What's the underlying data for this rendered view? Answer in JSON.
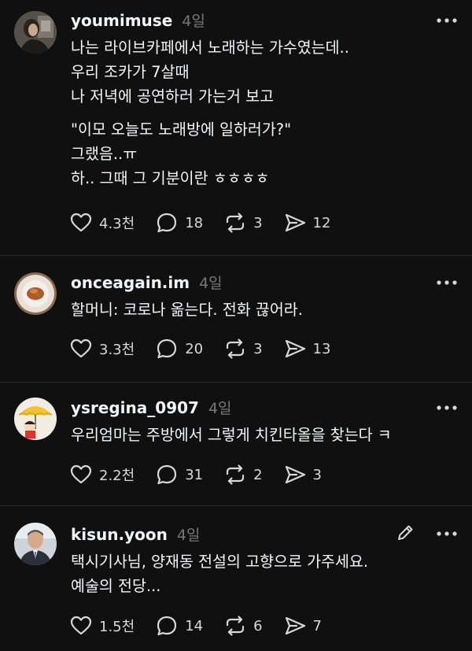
{
  "posts": [
    {
      "username": "youmimuse",
      "time": "4일",
      "paragraphs": [
        [
          "나는 라이브카페에서 노래하는 가수였는데..",
          "우리 조카가 7살때",
          "나 저녁에 공연하러 가는거 보고"
        ],
        [
          "\"이모 오늘도 노래방에 일하러가?\"",
          "그랬음..ㅠ",
          "하.. 그때 그 기분이란 ㅎㅎㅎㅎ"
        ]
      ],
      "likes": "4.3천",
      "comments": "18",
      "reposts": "3",
      "shares": "12"
    },
    {
      "username": "onceagain.im",
      "time": "4일",
      "paragraphs": [
        [
          "할머니: 코로나 옮는다. 전화 끊어라."
        ]
      ],
      "likes": "3.3천",
      "comments": "20",
      "reposts": "3",
      "shares": "13"
    },
    {
      "username": "ysregina_0907",
      "time": "4일",
      "paragraphs": [
        [
          "우리엄마는 주방에서 그렇게 치킨타올을 찾는다 ㅋ"
        ]
      ],
      "likes": "2.2천",
      "comments": "31",
      "reposts": "2",
      "shares": "3"
    },
    {
      "username": "kisun.yoon",
      "time": "4일",
      "paragraphs": [
        [
          "택시기사님, 양재동 전설의 고향으로 가주세요.",
          "예술의 전당..."
        ]
      ],
      "likes": "1.5천",
      "comments": "14",
      "reposts": "6",
      "shares": "7"
    }
  ],
  "icons": {
    "like": "heart-icon",
    "comment": "comment-bubble-icon",
    "repost": "repost-icon",
    "share": "send-icon",
    "more": "more-horizontal-icon",
    "edit": "pencil-icon"
  },
  "colors": {
    "background": "#101010",
    "text": "#f3f5f7",
    "muted": "#777777",
    "divider": "#2a2a2a"
  }
}
